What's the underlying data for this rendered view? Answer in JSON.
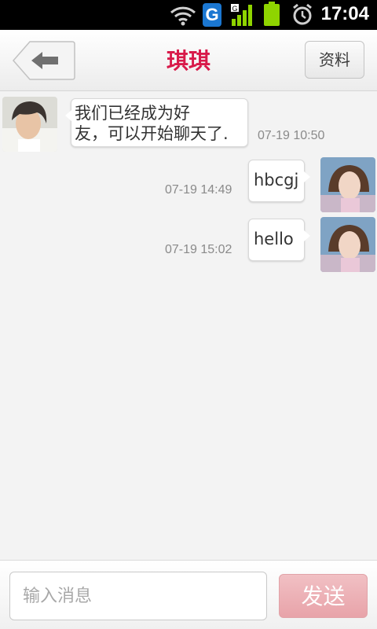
{
  "status_bar": {
    "time": "17:04",
    "icons": [
      "wifi-icon",
      "g-icon",
      "signal-icon",
      "battery-icon",
      "alarm-icon"
    ],
    "g_label": "G"
  },
  "header": {
    "title": "琪琪",
    "back_icon": "back-arrow-icon",
    "profile_label": "资料"
  },
  "messages": [
    {
      "side": "left",
      "text": "我们已经成为好\n友，可以开始聊天了.",
      "time": "07-19 10:50"
    },
    {
      "side": "right",
      "text": "hbcgj",
      "time": "07-19 14:49"
    },
    {
      "side": "right",
      "text": "hello",
      "time": "07-19 15:02"
    }
  ],
  "composer": {
    "placeholder": "输入消息",
    "send_label": "发送"
  },
  "colors": {
    "title": "#d81a4a",
    "send_button": "#e8a3a9",
    "timestamp": "#8a8a8a",
    "background": "#f3f3f3"
  }
}
